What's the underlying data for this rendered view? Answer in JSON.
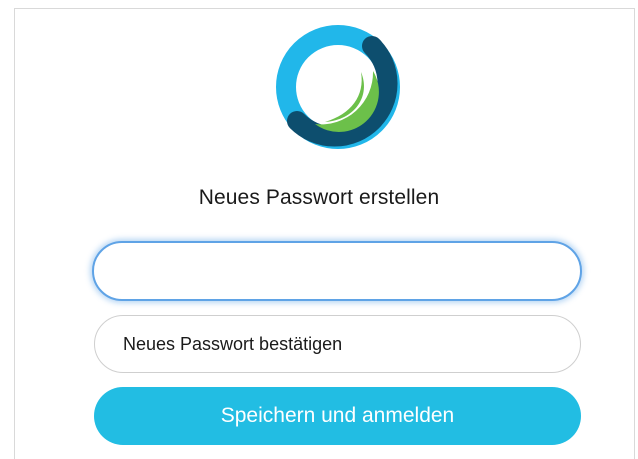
{
  "logo": {
    "icon": "webex-logo-icon",
    "colors": {
      "light_blue": "#21b7ea",
      "dark_blue": "#0d4e6e",
      "green": "#6cc04a"
    }
  },
  "form": {
    "title": "Neues Passwort erstellen",
    "new_password": {
      "value": "",
      "placeholder": ""
    },
    "confirm_password": {
      "value": "",
      "placeholder": "Neues Passwort bestätigen"
    },
    "submit_label": "Speichern und anmelden"
  },
  "colors": {
    "accent": "#22bde3",
    "focus_ring": "#5fa3e6"
  }
}
